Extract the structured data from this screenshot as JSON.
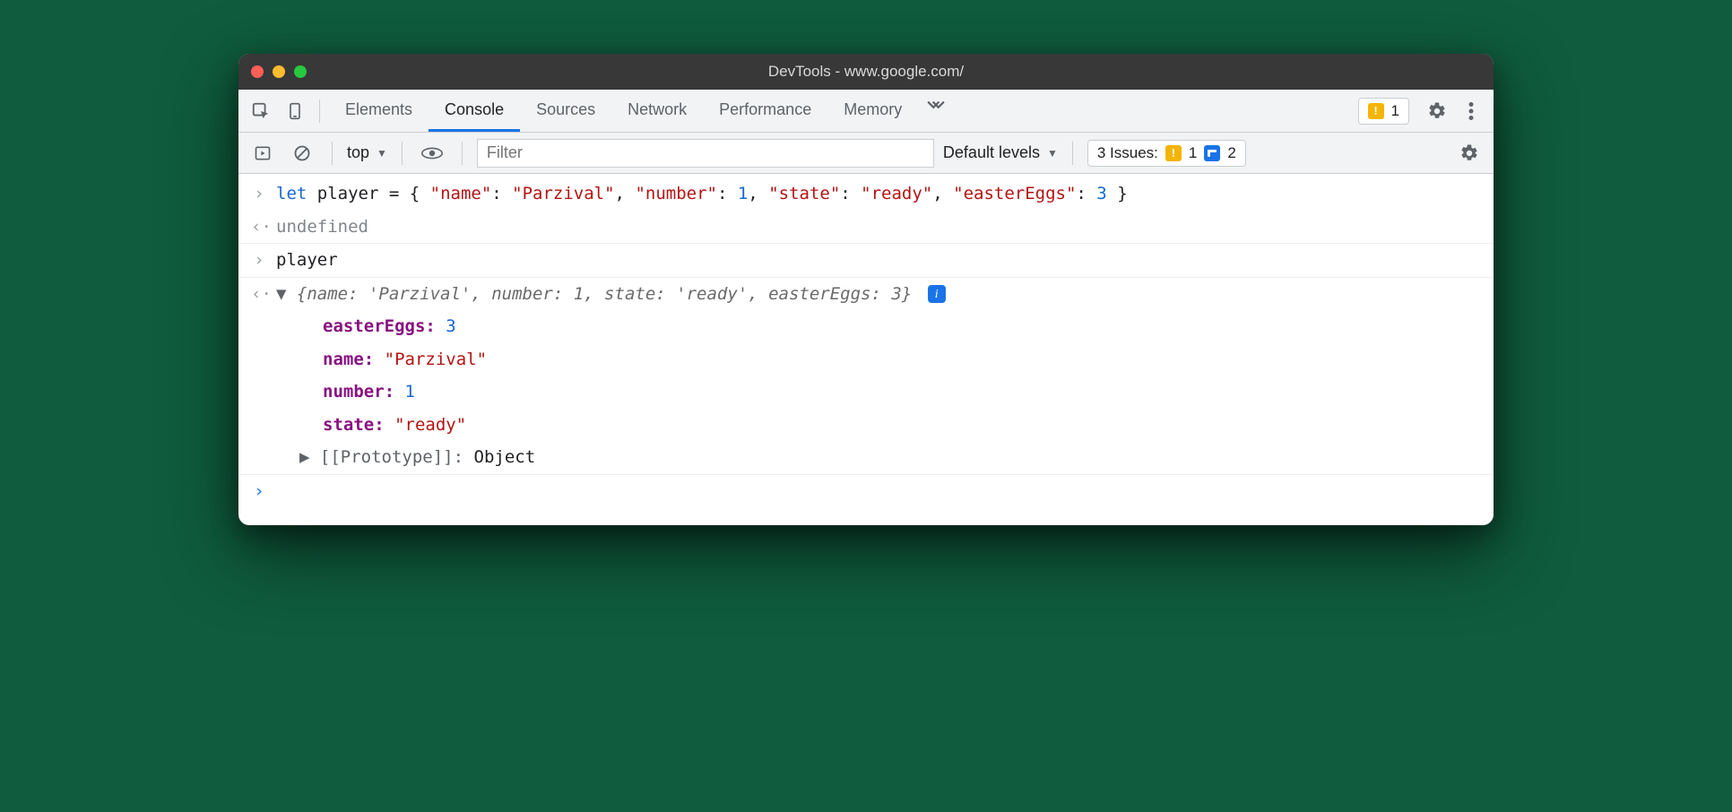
{
  "window": {
    "title": "DevTools - www.google.com/"
  },
  "tabs": {
    "elements": "Elements",
    "console": "Console",
    "sources": "Sources",
    "network": "Network",
    "performance": "Performance",
    "memory": "Memory"
  },
  "toolbar": {
    "hidden_warnings": "1"
  },
  "filterbar": {
    "context": "top",
    "filter_placeholder": "Filter",
    "levels": "Default levels",
    "issues_label": "3 Issues:",
    "issues_warn": "1",
    "issues_info": "2"
  },
  "console": {
    "line1": {
      "kw": "let",
      "var": "player",
      "eq": " = { ",
      "k_name": "\"name\"",
      "v_name": "\"Parzival\"",
      "k_number": "\"number\"",
      "v_number": "1",
      "k_state": "\"state\"",
      "v_state": "\"ready\"",
      "k_eggs": "\"easterEggs\"",
      "v_eggs": "3",
      "close": " }"
    },
    "line2": "undefined",
    "line3": "player",
    "summary": "{name: 'Parzival', number: 1, state: 'ready', easterEggs: 3}",
    "info_chip": "i",
    "props": {
      "easterEggs_k": "easterEggs",
      "easterEggs_v": "3",
      "name_k": "name",
      "name_v": "\"Parzival\"",
      "number_k": "number",
      "number_v": "1",
      "state_k": "state",
      "state_v": "\"ready\""
    },
    "proto": "[[Prototype]]",
    "proto_v": "Object"
  }
}
